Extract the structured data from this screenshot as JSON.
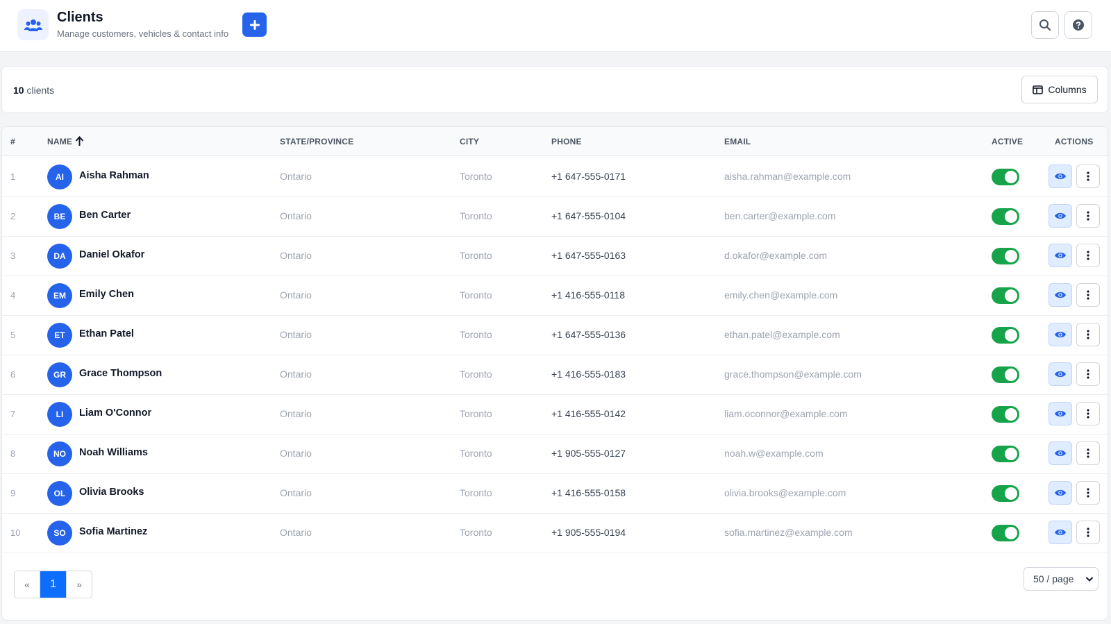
{
  "header": {
    "title": "Clients",
    "subtitle": "Manage customers, vehicles & contact info",
    "icon": "users-icon",
    "add_icon": "plus-icon",
    "search_icon": "search-icon",
    "help_icon": "help-circle-icon"
  },
  "toolbar": {
    "count": "10",
    "count_label": " clients",
    "columns_label": "Columns",
    "columns_icon": "columns-icon"
  },
  "table": {
    "headers": {
      "index": "#",
      "name": "NAME",
      "state": "STATE/PROVINCE",
      "city": "CITY",
      "phone": "PHONE",
      "email": "EMAIL",
      "active": "ACTIVE",
      "actions": "ACTIONS"
    },
    "sort_icon": "arrow-up-icon",
    "rows": [
      {
        "index": "1",
        "initials": "AI",
        "name": "Aisha Rahman",
        "state": "Ontario",
        "city": "Toronto",
        "phone": "+1 647-555-0171",
        "email": "aisha.rahman@example.com",
        "active": true
      },
      {
        "index": "2",
        "initials": "BE",
        "name": "Ben Carter",
        "state": "Ontario",
        "city": "Toronto",
        "phone": "+1 647-555-0104",
        "email": "ben.carter@example.com",
        "active": true
      },
      {
        "index": "3",
        "initials": "DA",
        "name": "Daniel Okafor",
        "state": "Ontario",
        "city": "Toronto",
        "phone": "+1 647-555-0163",
        "email": "d.okafor@example.com",
        "active": true
      },
      {
        "index": "4",
        "initials": "EM",
        "name": "Emily Chen",
        "state": "Ontario",
        "city": "Toronto",
        "phone": "+1 416-555-0118",
        "email": "emily.chen@example.com",
        "active": true
      },
      {
        "index": "5",
        "initials": "ET",
        "name": "Ethan Patel",
        "state": "Ontario",
        "city": "Toronto",
        "phone": "+1 647-555-0136",
        "email": "ethan.patel@example.com",
        "active": true
      },
      {
        "index": "6",
        "initials": "GR",
        "name": "Grace Thompson",
        "state": "Ontario",
        "city": "Toronto",
        "phone": "+1 416-555-0183",
        "email": "grace.thompson@example.com",
        "active": true
      },
      {
        "index": "7",
        "initials": "LI",
        "name": "Liam O'Connor",
        "state": "Ontario",
        "city": "Toronto",
        "phone": "+1 416-555-0142",
        "email": "liam.oconnor@example.com",
        "active": true
      },
      {
        "index": "8",
        "initials": "NO",
        "name": "Noah Williams",
        "state": "Ontario",
        "city": "Toronto",
        "phone": "+1 905-555-0127",
        "email": "noah.w@example.com",
        "active": true
      },
      {
        "index": "9",
        "initials": "OL",
        "name": "Olivia Brooks",
        "state": "Ontario",
        "city": "Toronto",
        "phone": "+1 416-555-0158",
        "email": "olivia.brooks@example.com",
        "active": true
      },
      {
        "index": "10",
        "initials": "SO",
        "name": "Sofia Martinez",
        "state": "Ontario",
        "city": "Toronto",
        "phone": "+1 905-555-0194",
        "email": "sofia.martinez@example.com",
        "active": true
      }
    ],
    "row_icons": {
      "view": "eye-icon",
      "more": "more-vertical-icon"
    }
  },
  "pagination": {
    "prev": "«",
    "current": "1",
    "next": "»",
    "per_page": "50 / page"
  },
  "colors": {
    "accent": "#2563eb",
    "toggle_on": "#16a34a",
    "page_active": "#0d6efd"
  }
}
